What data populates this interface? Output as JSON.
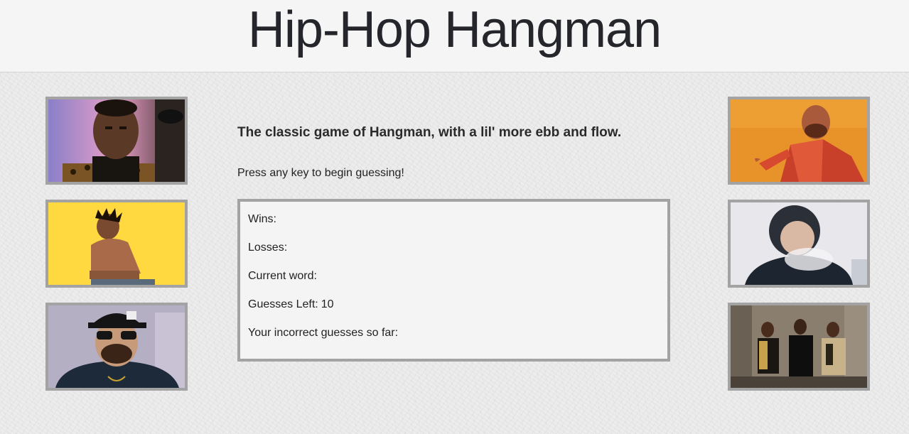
{
  "header": {
    "title": "Hip-Hop Hangman"
  },
  "intro": {
    "tagline": "The classic game of Hangman, with a lil' more ebb and flow.",
    "instruction": "Press any key to begin guessing!"
  },
  "stats": {
    "wins_label": "Wins:",
    "wins_value": "",
    "losses_label": "Losses:",
    "losses_value": "",
    "current_word_label": "Current word:",
    "current_word_value": "",
    "guesses_left_label": "Guesses Left:",
    "guesses_left_value": "10",
    "incorrect_label": "Your incorrect guesses so far:",
    "incorrect_value": ""
  },
  "gallery": {
    "left": [
      "rapper-portrait-dark-background",
      "rapper-on-yellow-background",
      "rapper-in-cap-and-sunglasses"
    ],
    "right": [
      "illustrated-rapper-orange",
      "rapper-in-hood-smoke",
      "rap-trio-group-photo"
    ]
  }
}
